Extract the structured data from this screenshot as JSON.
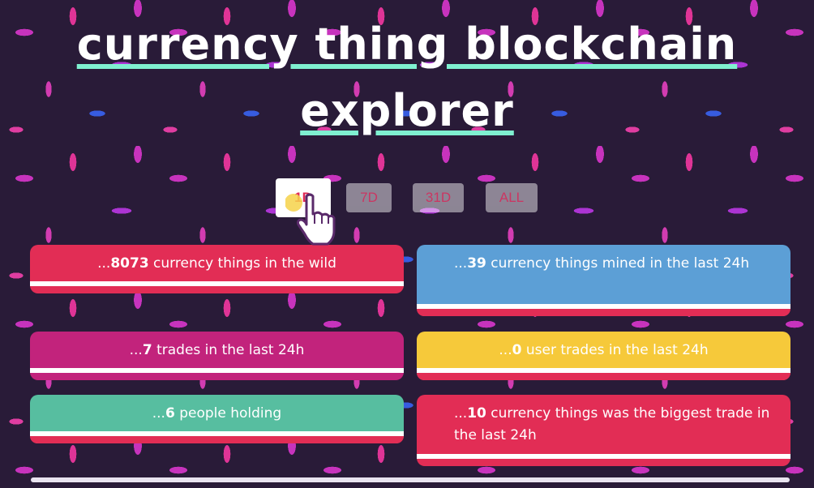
{
  "page": {
    "title_line1": "currency thing blockchain",
    "title_line2": "explorer"
  },
  "tabs": [
    {
      "label": "1D",
      "active": true
    },
    {
      "label": "7D",
      "active": false
    },
    {
      "label": "31D",
      "active": false
    },
    {
      "label": "ALL",
      "active": false
    }
  ],
  "cards": {
    "wild": {
      "prefix": "...",
      "value": "8073",
      "suffix": " currency things in the wild",
      "color": "#e22d55"
    },
    "mined": {
      "prefix": "...",
      "value": "39",
      "suffix": " currency things mined in the last 24h",
      "color": "#5c9fd6"
    },
    "trades": {
      "prefix": "...",
      "value": "7",
      "suffix": " trades in the last 24h",
      "color": "#c2237c"
    },
    "user_trades": {
      "prefix": "...",
      "value": "0",
      "suffix": " user trades in the last 24h",
      "color": "#f6c93a"
    },
    "holding": {
      "prefix": "...",
      "value": "6",
      "suffix": " people holding",
      "color": "#57bea0"
    },
    "biggest": {
      "prefix": "...",
      "value": "10",
      "suffix": " currency things was the biggest trade in the last 24h",
      "color": "#e22d55"
    }
  },
  "icons": {
    "cursor": "hand-pointer-icon"
  }
}
